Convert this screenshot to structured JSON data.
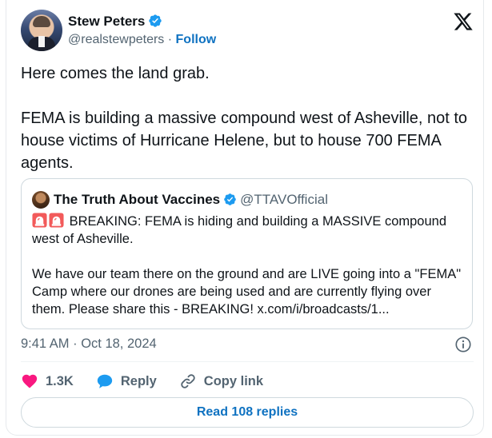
{
  "author": {
    "name": "Stew Peters",
    "handle": "@realstewpeters",
    "separator": " · ",
    "follow_label": "Follow"
  },
  "tweet": {
    "text": "Here comes the land grab.\n\nFEMA is building a massive compound west of Asheville, not to house victims of Hurricane Helene, but to house 700 FEMA agents."
  },
  "quote": {
    "name": "The Truth About Vaccines",
    "handle": "@TTAVOfficial",
    "paragraph1": "BREAKING: FEMA is hiding and building a MASSIVE compound west of Asheville.",
    "paragraph2": "We have our team there on the ground and are LIVE going into a \"FEMA\" Camp where our drones are being used and are currently flying over them. Please share this - BREAKING! x.com/i/broadcasts/1..."
  },
  "meta": {
    "timestamp": "9:41 AM · Oct 18, 2024"
  },
  "actions": {
    "like_count": "1.3K",
    "reply_label": "Reply",
    "copy_label": "Copy link"
  },
  "footer": {
    "read_replies_label": "Read 108 replies"
  },
  "icons": {
    "verified": "verified-badge-icon",
    "x_logo": "x-logo-icon",
    "siren": "siren-emoji-icon",
    "info": "info-icon",
    "like": "heart-icon",
    "reply": "speech-bubble-icon",
    "copy": "link-icon"
  },
  "colors": {
    "verified": "#1d9bf0",
    "link": "#0f72c1",
    "like": "#f91880",
    "reply": "#1d9bf0",
    "secondary_text": "#536471"
  }
}
